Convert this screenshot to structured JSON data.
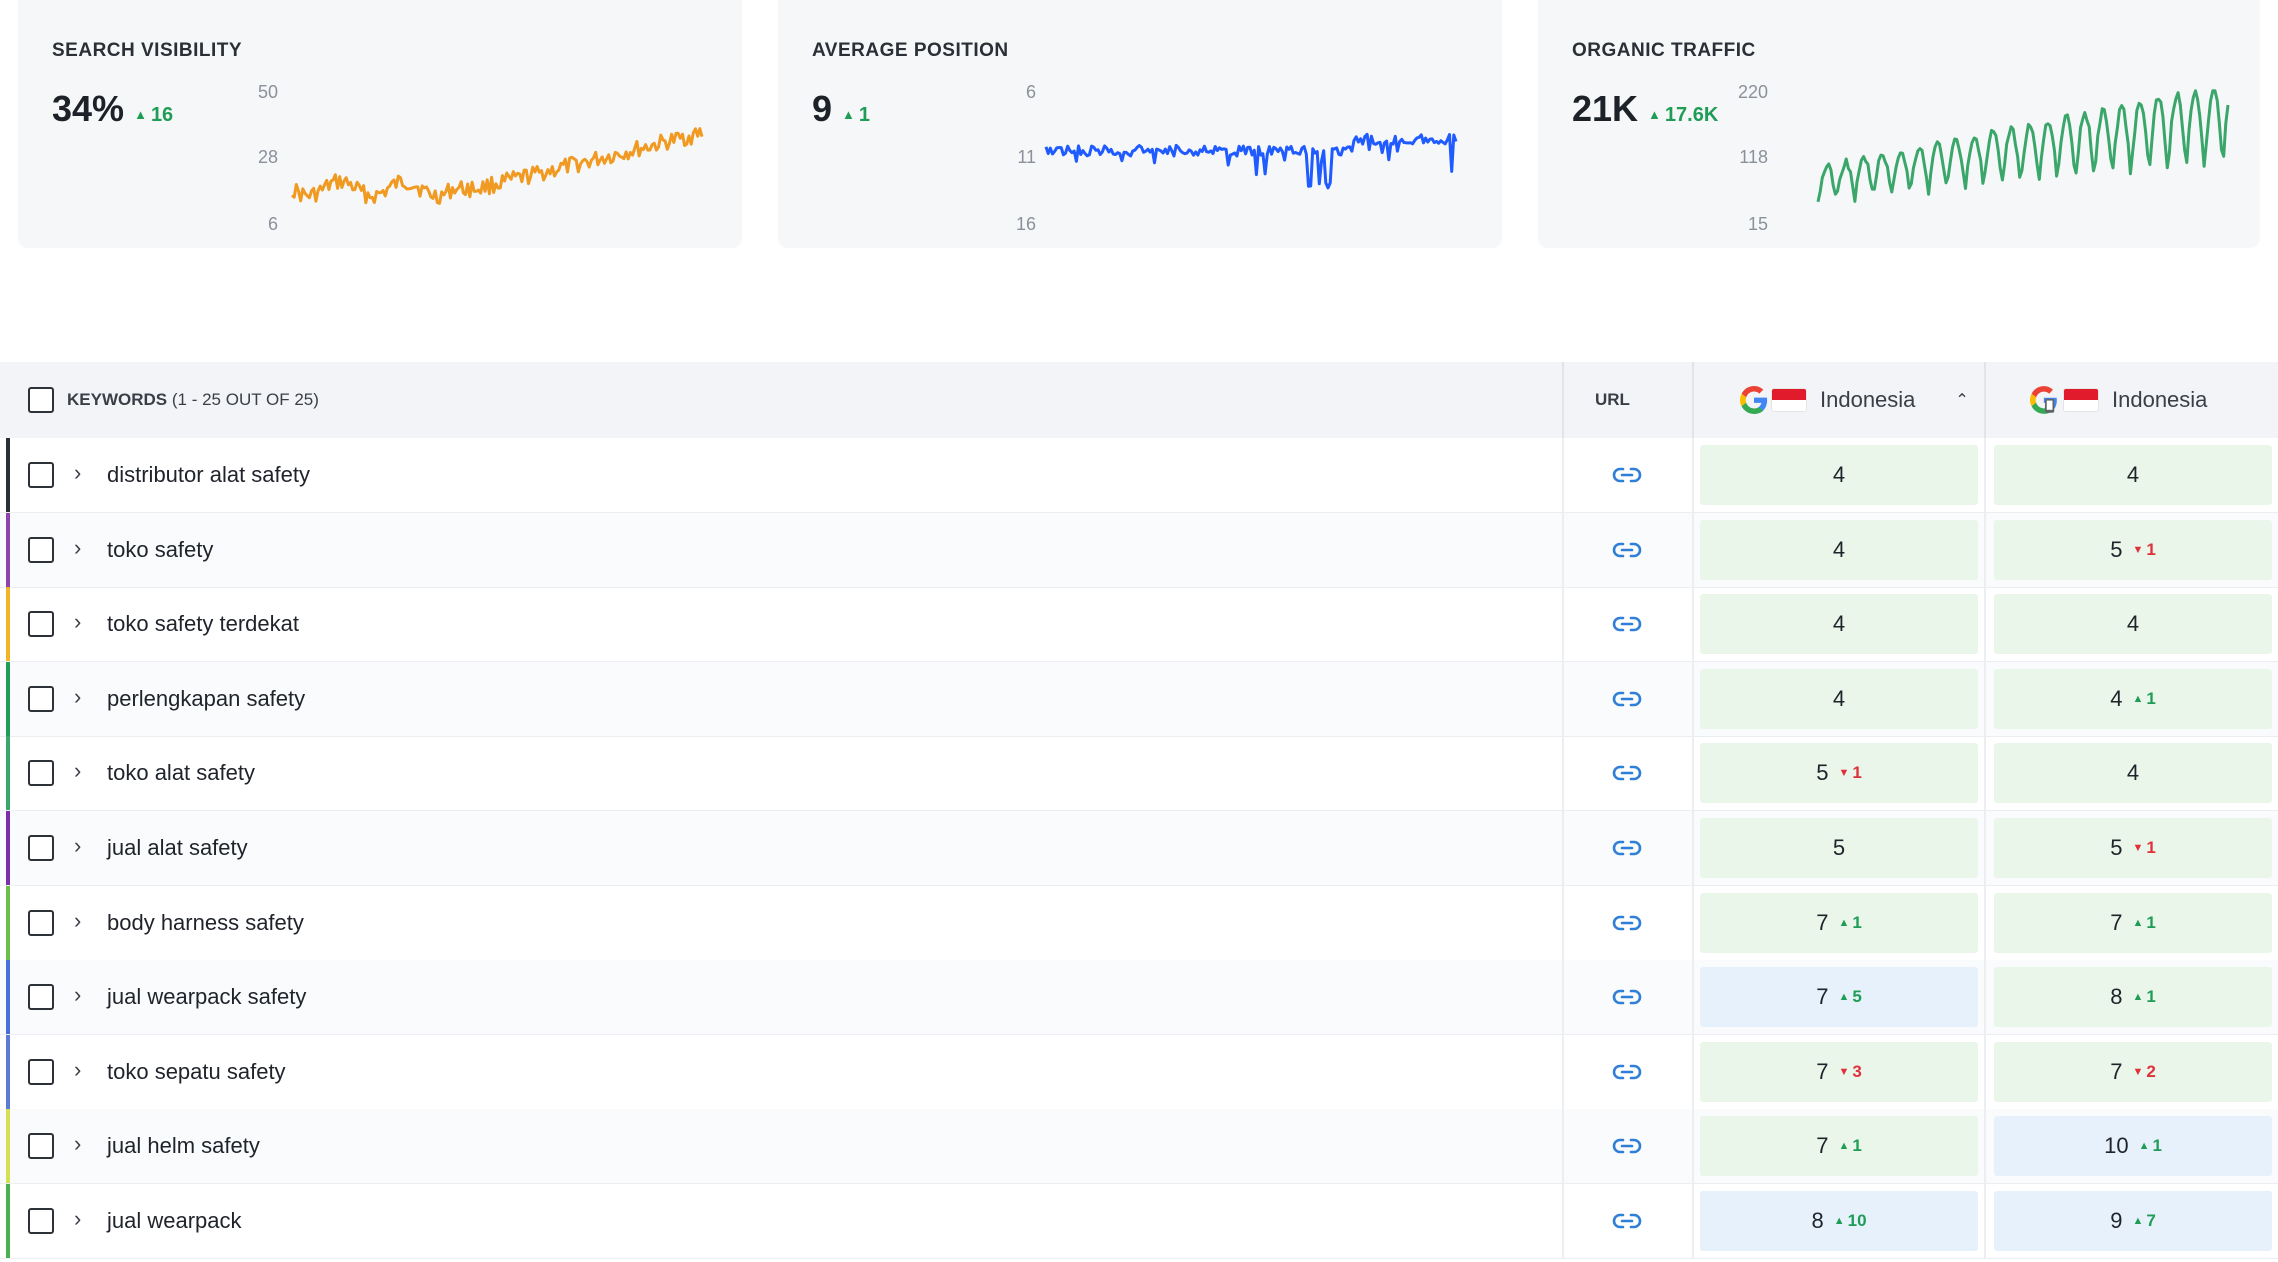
{
  "cards": [
    {
      "title": "SEARCH VISIBILITY",
      "value": "34%",
      "delta": "16",
      "delta_direction": "up",
      "axis": [
        "50",
        "28",
        "6"
      ],
      "line_color": "#f09a22"
    },
    {
      "title": "AVERAGE POSITION",
      "value": "9",
      "delta": "1",
      "delta_direction": "up",
      "axis": [
        "6",
        "11",
        "16"
      ],
      "line_color": "#1f5bff"
    },
    {
      "title": "ORGANIC TRAFFIC",
      "value": "21K",
      "delta": "17.6K",
      "delta_direction": "up",
      "axis": [
        "220",
        "118",
        "15"
      ],
      "line_color": "#3aa66a"
    }
  ],
  "table": {
    "header": {
      "keywords_label": "KEYWORDS",
      "keywords_count": "(1 - 25 OUT OF 25)",
      "url_label": "URL",
      "engine1_country": "Indonesia",
      "engine2_country": "Indonesia"
    },
    "rows": [
      {
        "keyword": "distributor alat safety",
        "bar": "#2b2f36",
        "c1": {
          "pos": "4",
          "chg": "",
          "dir": "",
          "bg": "green"
        },
        "c2": {
          "pos": "4",
          "chg": "",
          "dir": "",
          "bg": "green"
        }
      },
      {
        "keyword": "toko safety",
        "bar": "#8e44ad",
        "c1": {
          "pos": "4",
          "chg": "",
          "dir": "",
          "bg": "green"
        },
        "c2": {
          "pos": "5",
          "chg": "1",
          "dir": "down",
          "bg": "green"
        }
      },
      {
        "keyword": "toko safety terdekat",
        "bar": "#f0b429",
        "c1": {
          "pos": "4",
          "chg": "",
          "dir": "",
          "bg": "green"
        },
        "c2": {
          "pos": "4",
          "chg": "",
          "dir": "",
          "bg": "green"
        }
      },
      {
        "keyword": "perlengkapan safety",
        "bar": "#1f9d57",
        "c1": {
          "pos": "4",
          "chg": "",
          "dir": "",
          "bg": "green"
        },
        "c2": {
          "pos": "4",
          "chg": "1",
          "dir": "up",
          "bg": "green"
        }
      },
      {
        "keyword": "toko alat safety",
        "bar": "#3aa66a",
        "c1": {
          "pos": "5",
          "chg": "1",
          "dir": "down",
          "bg": "green"
        },
        "c2": {
          "pos": "4",
          "chg": "",
          "dir": "",
          "bg": "green"
        }
      },
      {
        "keyword": "jual alat safety",
        "bar": "#7b2fa8",
        "c1": {
          "pos": "5",
          "chg": "",
          "dir": "",
          "bg": "green"
        },
        "c2": {
          "pos": "5",
          "chg": "1",
          "dir": "down",
          "bg": "green"
        }
      },
      {
        "keyword": "body harness safety",
        "bar": "#6cc04a",
        "c1": {
          "pos": "7",
          "chg": "1",
          "dir": "up",
          "bg": "green"
        },
        "c2": {
          "pos": "7",
          "chg": "1",
          "dir": "up",
          "bg": "green"
        }
      },
      {
        "keyword": "jual wearpack safety",
        "bar": "#4a6fd8",
        "c1": {
          "pos": "7",
          "chg": "5",
          "dir": "up",
          "bg": "blue"
        },
        "c2": {
          "pos": "8",
          "chg": "1",
          "dir": "up",
          "bg": "green"
        }
      },
      {
        "keyword": "toko sepatu safety",
        "bar": "#5b7bd5",
        "c1": {
          "pos": "7",
          "chg": "3",
          "dir": "down",
          "bg": "green"
        },
        "c2": {
          "pos": "7",
          "chg": "2",
          "dir": "down",
          "bg": "green"
        }
      },
      {
        "keyword": "jual helm safety",
        "bar": "#d4e157",
        "c1": {
          "pos": "7",
          "chg": "1",
          "dir": "up",
          "bg": "green"
        },
        "c2": {
          "pos": "10",
          "chg": "1",
          "dir": "up",
          "bg": "blue"
        }
      },
      {
        "keyword": "jual wearpack",
        "bar": "#4caf50",
        "c1": {
          "pos": "8",
          "chg": "10",
          "dir": "up",
          "bg": "blue"
        },
        "c2": {
          "pos": "9",
          "chg": "7",
          "dir": "up",
          "bg": "blue"
        }
      }
    ]
  }
}
